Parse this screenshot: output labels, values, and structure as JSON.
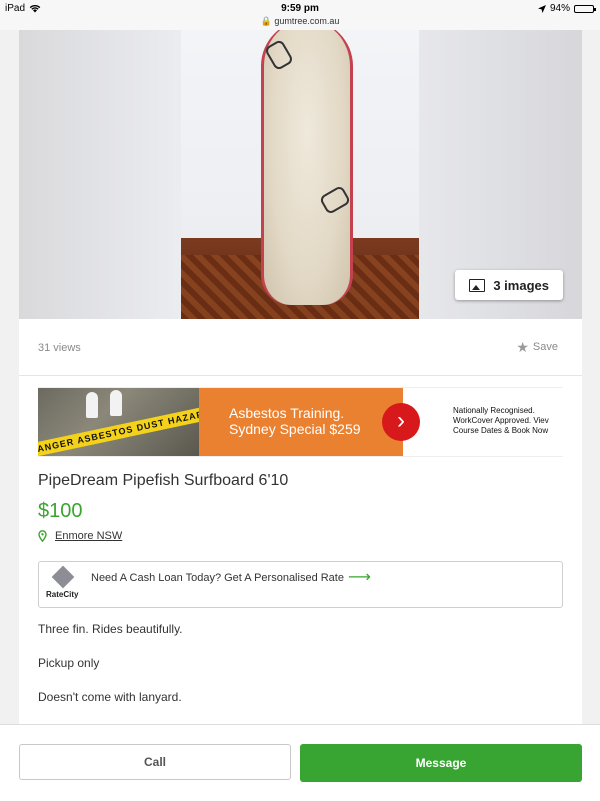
{
  "status_bar": {
    "device": "iPad",
    "time": "9:59 pm",
    "url": "gumtree.com.au",
    "battery": "94%",
    "battery_level": 0.94
  },
  "listing": {
    "image_count_label": "3 images",
    "views": "31 views",
    "save_label": "Save",
    "title": "PipeDream Pipefish Surfboard 6'10",
    "price": "$100",
    "location": "Enmore NSW",
    "description": [
      "Three fin. Rides beautifully.",
      "Pickup only",
      "Doesn't come with lanyard."
    ]
  },
  "ad_banner": {
    "tape_text": "DANGER ASBESTOS DUST HAZARD",
    "title_line1": "Asbestos Training.",
    "title_line2": "Sydney Special $259",
    "text_line1": "Nationally Recognised.",
    "text_line2": "WorkCover Approved. Viev",
    "text_line3": "Course Dates & Book Now"
  },
  "loan_ad": {
    "brand": "RateCity",
    "text": "Need A Cash Loan Today? Get A Personalised Rate"
  },
  "actions": {
    "call_label": "Call",
    "message_label": "Message"
  },
  "colors": {
    "accent_green": "#38a533",
    "ad_orange": "#ea8130",
    "ad_red": "#d7191c"
  }
}
